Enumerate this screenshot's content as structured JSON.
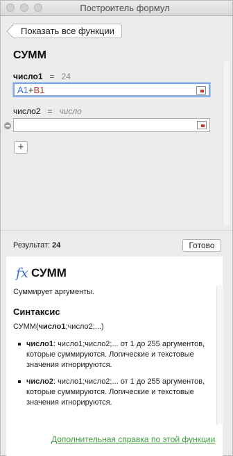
{
  "window": {
    "title": "Построитель формул"
  },
  "nav": {
    "back_label": "Показать все функции"
  },
  "function": {
    "name": "СУММ"
  },
  "arguments": [
    {
      "name": "число1",
      "equals": "=",
      "value": "24",
      "input_ref_a": "A1",
      "input_op": "+",
      "input_ref_b": "B1"
    },
    {
      "name": "число2",
      "equals": "=",
      "value": "число",
      "input_value": ""
    }
  ],
  "add_argument": {
    "label": "+"
  },
  "result": {
    "label": "Результат:",
    "value": "24"
  },
  "done": {
    "label": "Готово"
  },
  "help": {
    "fx_symbol": "fx",
    "title": "СУММ",
    "description": "Суммирует аргументы.",
    "syntax_heading": "Синтаксис",
    "syntax_func": "СУММ(",
    "syntax_arg1": "число1",
    "syntax_rest": ";число2;...)",
    "args": [
      {
        "name": "число1",
        "text": ": число1;число2;... от 1 до 255 аргументов, которые суммируются. Логические и текстовые значения игнорируются."
      },
      {
        "name": "число2",
        "text": ": число1;число2;... от 1 до 255 аргументов, которые суммируются. Логические и текстовые значения игнорируются."
      }
    ],
    "more_link": "Дополнительная справка по этой функции"
  },
  "colors": {
    "ref_a": "#3a6fd8",
    "ref_b": "#c3302f",
    "link": "#3f9c3f",
    "focus": "#7fa9e6"
  }
}
